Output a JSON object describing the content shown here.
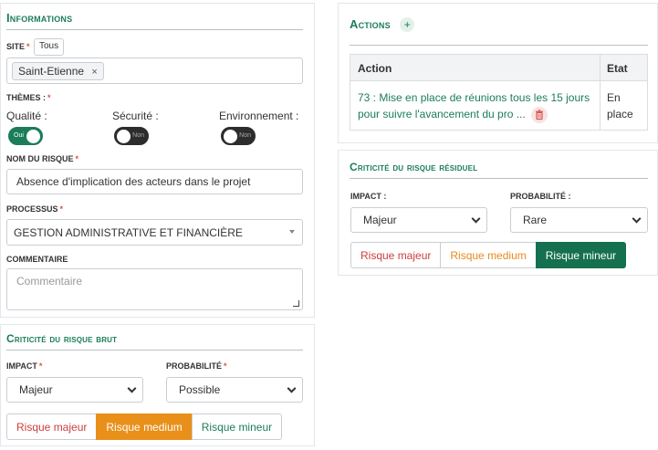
{
  "informations": {
    "title": "Informations",
    "site_label": "SITE",
    "site_tous": "Tous",
    "site_tag": "Saint-Etienne",
    "themes_label": "THÈMES :",
    "themes": [
      {
        "label": "Qualité :",
        "state": "Oui"
      },
      {
        "label": "Sécurité :",
        "state": "Non"
      },
      {
        "label": "Environnement :",
        "state": "Non"
      }
    ],
    "risk_name_label": "NOM DU RISQUE",
    "risk_name_value": "Absence d'implication des acteurs dans le projet",
    "process_label": "PROCESSUS",
    "process_value": "GESTION ADMINISTRATIVE ET FINANCIÈRE",
    "comment_label": "COMMENTAIRE",
    "comment_placeholder": "Commentaire"
  },
  "brut": {
    "title": "Criticité du risque brut",
    "impact_label": "IMPACT",
    "impact_value": "Majeur",
    "proba_label": "PROBABILITÉ",
    "proba_value": "Possible",
    "buttons": [
      "Risque majeur",
      "Risque medium",
      "Risque mineur"
    ],
    "active": "Risque medium"
  },
  "actions": {
    "title": "Actions",
    "add_symbol": "+",
    "col_action": "Action",
    "col_etat": "Etat",
    "row_text": "73 : Mise en place de réunions tous les 15 jours pour suivre l'avancement du pro ...",
    "row_etat": "En place"
  },
  "residuel": {
    "title": "Criticité du risque résiduel",
    "impact_label": "IMPACT :",
    "impact_value": "Majeur",
    "proba_label": "PROBABILITÉ :",
    "proba_value": "Rare",
    "buttons": [
      "Risque majeur",
      "Risque medium",
      "Risque mineur"
    ],
    "active": "Risque mineur"
  },
  "colors": {
    "accent_green": "#1b7d5a",
    "required_red": "#d9534f",
    "medium_orange": "#e8901a",
    "delete_red": "#d9534f"
  }
}
